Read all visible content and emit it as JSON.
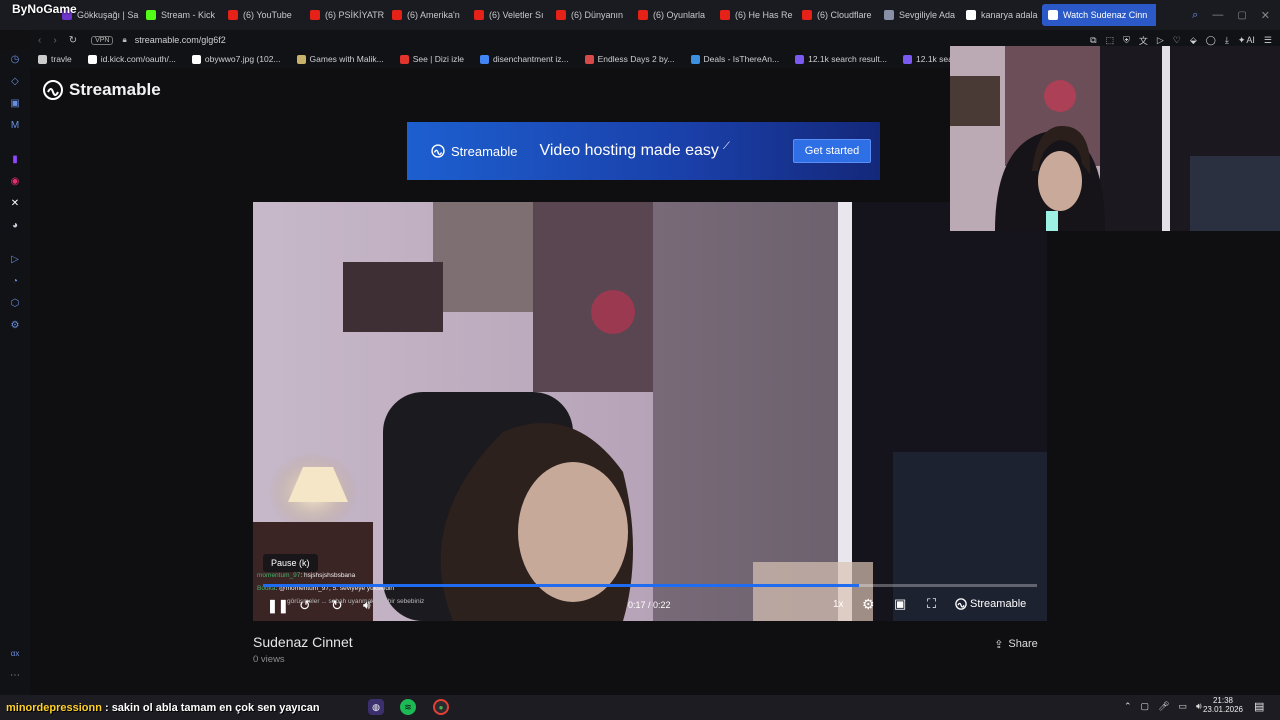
{
  "overlay": {
    "brand": "ByNoGame"
  },
  "tabs": [
    {
      "label": "Gökkuşağı | Sa",
      "color": "#6e35c9"
    },
    {
      "label": "Stream - Kick",
      "color": "#53fc18"
    },
    {
      "label": "(6) YouTube",
      "color": "#e62117"
    },
    {
      "label": "(6) PSİKİYATR",
      "color": "#e62117"
    },
    {
      "label": "(6) Amerika'n",
      "color": "#e62117"
    },
    {
      "label": "(6) Veletler Sı",
      "color": "#e62117"
    },
    {
      "label": "(6) Dünyanın",
      "color": "#e62117"
    },
    {
      "label": "(6) Oyunlarla",
      "color": "#e62117"
    },
    {
      "label": "(6) He Has Re",
      "color": "#e62117"
    },
    {
      "label": "(6) Cloudflare",
      "color": "#e62117"
    },
    {
      "label": "Sevgiliyle Ada",
      "color": "#8a8fa8"
    },
    {
      "label": "kanarya adala",
      "color": "#ffffff"
    },
    {
      "label": "Watch Sudenaz Cinn",
      "color": "#ffffff",
      "active": true
    }
  ],
  "address": {
    "vpn": "VPN",
    "url": "streamable.com/glg6f2"
  },
  "bookmarks": [
    {
      "label": "travle",
      "color": "#cccccc"
    },
    {
      "label": "id.kick.com/oauth/...",
      "color": "#ffffff"
    },
    {
      "label": "obywwo7.jpg (102...",
      "color": "#ffffff"
    },
    {
      "label": "Games with Malik...",
      "color": "#c8b26a"
    },
    {
      "label": "See | Dizi izle",
      "color": "#e0342c"
    },
    {
      "label": "disenchantment iz...",
      "color": "#4285f4"
    },
    {
      "label": "Endless Days 2 by...",
      "color": "#d84a4a"
    },
    {
      "label": "Deals - IsThereAn...",
      "color": "#3d8fe0"
    },
    {
      "label": "12.1k search result...",
      "color": "#7a5af0"
    },
    {
      "label": "12.1k search res",
      "color": "#7a5af0"
    }
  ],
  "toolbar_icons": [
    "extension-icon",
    "screenshot-icon",
    "shield-icon",
    "translate-icon",
    "send-icon",
    "heart-icon",
    "puzzle-icon",
    "account-icon",
    "download-icon",
    "ai-icon",
    "menu-icon"
  ],
  "toolbar": {
    "ai_label": "AI"
  },
  "page": {
    "logo_text": "Streamable",
    "ad": {
      "brand": "Streamable",
      "headline": "Video hosting made easy",
      "cta": "Get started"
    },
    "video": {
      "tooltip": "Pause (k)",
      "time": "0:17 / 0:22",
      "progress": 0.77,
      "speed": "1x",
      "brand": "Streamable",
      "chat": [
        {
          "user": "momentum_97",
          "text": ": hsjshsjshsbsbana"
        },
        {
          "user": "Bodka",
          "text": ": @momentum_97, 5. seviyeye yükseldin"
        },
        {
          "user": "",
          "text": "görüşmeler ... sabah uyanmak için bir sebebiniz"
        }
      ]
    },
    "title": "Sudenaz Cinnet",
    "views": "0 views",
    "share_label": "Share"
  },
  "taskbar": {
    "chat_user": "minordepressionn",
    "chat_text": ": sakin ol abla tamam en çok sen yayıcan",
    "time": "21:38",
    "date": "23.01.2026"
  }
}
